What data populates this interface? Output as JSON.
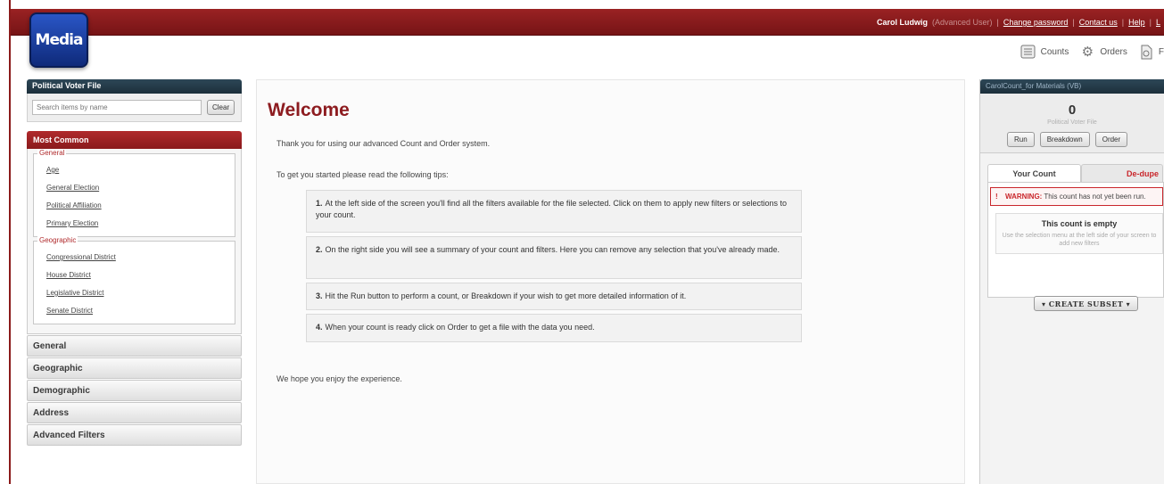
{
  "topbar": {
    "user_name": "Carol Ludwig",
    "user_role": "(Advanced User)",
    "links": [
      "Change password",
      "Contact us",
      "Help",
      "L"
    ]
  },
  "logo": {
    "text": "Media"
  },
  "toolbar": {
    "counts_label": "Counts",
    "orders_label": "Orders",
    "third_label": "F"
  },
  "left_panel": {
    "title": "Political Voter File",
    "search_placeholder": "Search items by name",
    "clear_label": "Clear",
    "most_common_title": "Most Common",
    "groups": [
      {
        "legend": "General",
        "items": [
          "Age",
          "General Election",
          "Political Affiliation",
          "Primary Election"
        ]
      },
      {
        "legend": "Geographic",
        "items": [
          "Congressional District",
          "House District",
          "Legislative District",
          "Senate District"
        ]
      }
    ],
    "accordion": [
      "General",
      "Geographic",
      "Demographic",
      "Address",
      "Advanced Filters"
    ]
  },
  "main": {
    "title": "Welcome",
    "intro": "Thank you for using our advanced Count and Order system.",
    "tips_intro": "To get you started please read the following tips:",
    "tips": [
      {
        "num": "1.",
        "text": "At the left side of the screen you'll find all the filters available for the file selected. Click on them to apply new filters or selections to your count."
      },
      {
        "num": "2.",
        "text": "On the right side you will see a summary of your count and filters. Here you can remove any selection that you've already made."
      },
      {
        "num": "3.",
        "text": "Hit the Run button to perform a count, or Breakdown if your wish to get more detailed information of it."
      },
      {
        "num": "4.",
        "text": "When your count is ready click on Order to get a file with the data you need."
      }
    ],
    "outro": "We hope you enjoy the experience."
  },
  "right_panel": {
    "title": "CarolCount_for Materials (VB)",
    "count": "0",
    "source": "Political Voter File",
    "run_label": "Run",
    "breakdown_label": "Breakdown",
    "order_label": "Order",
    "tab_count": "Your Count",
    "tab_other": "De-dupe",
    "warning_label": "WARNING:",
    "warning_text": "This count has not yet been run.",
    "empty_title": "This count is empty",
    "empty_desc": "Use the selection menu at the left side of your screen to add new filters",
    "subset_label": "▾ CREATE SUBSET ▾"
  }
}
